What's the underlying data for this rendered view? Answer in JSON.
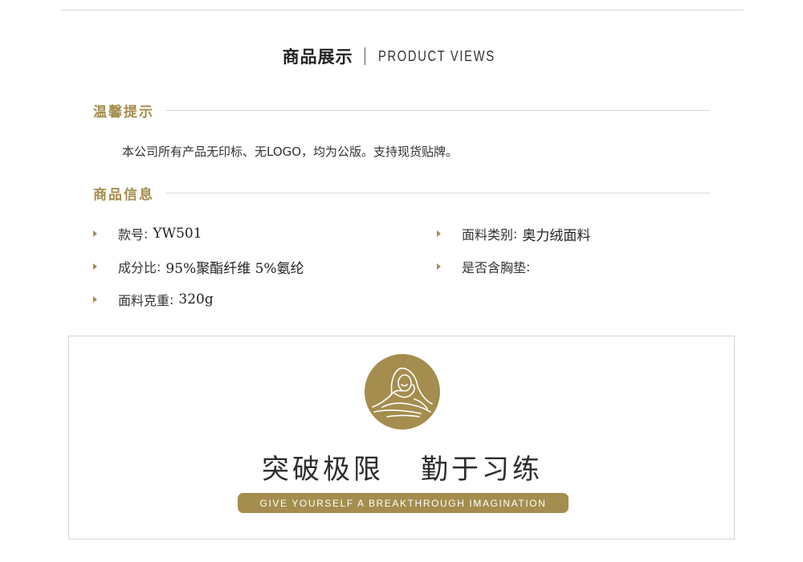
{
  "header": {
    "title_cn": "商品展示",
    "title_en": "PRODUCT VIEWS"
  },
  "notice": {
    "heading": "温馨提示",
    "text": "本公司所有产品无印标、无LOGO，均为公版。支持现货贴牌。"
  },
  "product_info": {
    "heading": "商品信息",
    "items": [
      {
        "key": "款号",
        "value": "YW501"
      },
      {
        "key": "面料类别",
        "value": "奥力绒面料"
      },
      {
        "key": "成分比",
        "value": "95%聚酯纤维 5%氨纶"
      },
      {
        "key": "是否含胸垫",
        "value": ""
      },
      {
        "key": "面料克重",
        "value": "320g"
      }
    ]
  },
  "banner": {
    "icon": "meditation-figure-icon",
    "slogan_part1": "突破极限",
    "slogan_part2": "勤于习练",
    "tagline": "GIVE YOURSELF A BREAKTHROUGH IMAGINATION"
  },
  "colors": {
    "accent": "#a48d4e",
    "text": "#333333",
    "rule": "#d8d8d8"
  }
}
